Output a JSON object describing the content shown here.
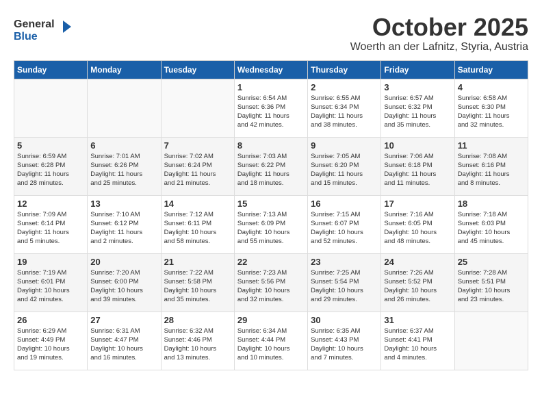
{
  "header": {
    "logo_general": "General",
    "logo_blue": "Blue",
    "month": "October 2025",
    "location": "Woerth an der Lafnitz, Styria, Austria"
  },
  "weekdays": [
    "Sunday",
    "Monday",
    "Tuesday",
    "Wednesday",
    "Thursday",
    "Friday",
    "Saturday"
  ],
  "weeks": [
    [
      {
        "day": "",
        "info": ""
      },
      {
        "day": "",
        "info": ""
      },
      {
        "day": "",
        "info": ""
      },
      {
        "day": "1",
        "info": "Sunrise: 6:54 AM\nSunset: 6:36 PM\nDaylight: 11 hours\nand 42 minutes."
      },
      {
        "day": "2",
        "info": "Sunrise: 6:55 AM\nSunset: 6:34 PM\nDaylight: 11 hours\nand 38 minutes."
      },
      {
        "day": "3",
        "info": "Sunrise: 6:57 AM\nSunset: 6:32 PM\nDaylight: 11 hours\nand 35 minutes."
      },
      {
        "day": "4",
        "info": "Sunrise: 6:58 AM\nSunset: 6:30 PM\nDaylight: 11 hours\nand 32 minutes."
      }
    ],
    [
      {
        "day": "5",
        "info": "Sunrise: 6:59 AM\nSunset: 6:28 PM\nDaylight: 11 hours\nand 28 minutes."
      },
      {
        "day": "6",
        "info": "Sunrise: 7:01 AM\nSunset: 6:26 PM\nDaylight: 11 hours\nand 25 minutes."
      },
      {
        "day": "7",
        "info": "Sunrise: 7:02 AM\nSunset: 6:24 PM\nDaylight: 11 hours\nand 21 minutes."
      },
      {
        "day": "8",
        "info": "Sunrise: 7:03 AM\nSunset: 6:22 PM\nDaylight: 11 hours\nand 18 minutes."
      },
      {
        "day": "9",
        "info": "Sunrise: 7:05 AM\nSunset: 6:20 PM\nDaylight: 11 hours\nand 15 minutes."
      },
      {
        "day": "10",
        "info": "Sunrise: 7:06 AM\nSunset: 6:18 PM\nDaylight: 11 hours\nand 11 minutes."
      },
      {
        "day": "11",
        "info": "Sunrise: 7:08 AM\nSunset: 6:16 PM\nDaylight: 11 hours\nand 8 minutes."
      }
    ],
    [
      {
        "day": "12",
        "info": "Sunrise: 7:09 AM\nSunset: 6:14 PM\nDaylight: 11 hours\nand 5 minutes."
      },
      {
        "day": "13",
        "info": "Sunrise: 7:10 AM\nSunset: 6:12 PM\nDaylight: 11 hours\nand 2 minutes."
      },
      {
        "day": "14",
        "info": "Sunrise: 7:12 AM\nSunset: 6:11 PM\nDaylight: 10 hours\nand 58 minutes."
      },
      {
        "day": "15",
        "info": "Sunrise: 7:13 AM\nSunset: 6:09 PM\nDaylight: 10 hours\nand 55 minutes."
      },
      {
        "day": "16",
        "info": "Sunrise: 7:15 AM\nSunset: 6:07 PM\nDaylight: 10 hours\nand 52 minutes."
      },
      {
        "day": "17",
        "info": "Sunrise: 7:16 AM\nSunset: 6:05 PM\nDaylight: 10 hours\nand 48 minutes."
      },
      {
        "day": "18",
        "info": "Sunrise: 7:18 AM\nSunset: 6:03 PM\nDaylight: 10 hours\nand 45 minutes."
      }
    ],
    [
      {
        "day": "19",
        "info": "Sunrise: 7:19 AM\nSunset: 6:01 PM\nDaylight: 10 hours\nand 42 minutes."
      },
      {
        "day": "20",
        "info": "Sunrise: 7:20 AM\nSunset: 6:00 PM\nDaylight: 10 hours\nand 39 minutes."
      },
      {
        "day": "21",
        "info": "Sunrise: 7:22 AM\nSunset: 5:58 PM\nDaylight: 10 hours\nand 35 minutes."
      },
      {
        "day": "22",
        "info": "Sunrise: 7:23 AM\nSunset: 5:56 PM\nDaylight: 10 hours\nand 32 minutes."
      },
      {
        "day": "23",
        "info": "Sunrise: 7:25 AM\nSunset: 5:54 PM\nDaylight: 10 hours\nand 29 minutes."
      },
      {
        "day": "24",
        "info": "Sunrise: 7:26 AM\nSunset: 5:52 PM\nDaylight: 10 hours\nand 26 minutes."
      },
      {
        "day": "25",
        "info": "Sunrise: 7:28 AM\nSunset: 5:51 PM\nDaylight: 10 hours\nand 23 minutes."
      }
    ],
    [
      {
        "day": "26",
        "info": "Sunrise: 6:29 AM\nSunset: 4:49 PM\nDaylight: 10 hours\nand 19 minutes."
      },
      {
        "day": "27",
        "info": "Sunrise: 6:31 AM\nSunset: 4:47 PM\nDaylight: 10 hours\nand 16 minutes."
      },
      {
        "day": "28",
        "info": "Sunrise: 6:32 AM\nSunset: 4:46 PM\nDaylight: 10 hours\nand 13 minutes."
      },
      {
        "day": "29",
        "info": "Sunrise: 6:34 AM\nSunset: 4:44 PM\nDaylight: 10 hours\nand 10 minutes."
      },
      {
        "day": "30",
        "info": "Sunrise: 6:35 AM\nSunset: 4:43 PM\nDaylight: 10 hours\nand 7 minutes."
      },
      {
        "day": "31",
        "info": "Sunrise: 6:37 AM\nSunset: 4:41 PM\nDaylight: 10 hours\nand 4 minutes."
      },
      {
        "day": "",
        "info": ""
      }
    ]
  ]
}
